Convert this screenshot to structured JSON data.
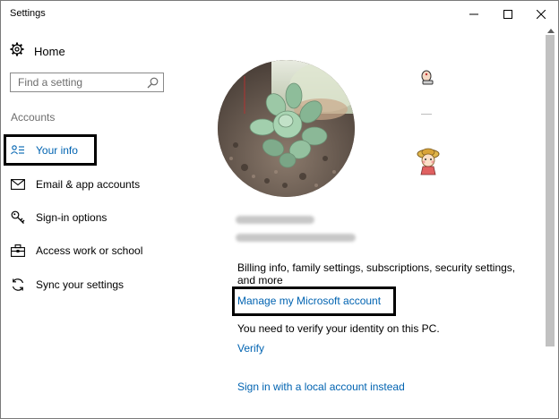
{
  "window": {
    "title": "Settings",
    "controls": [
      "minimize",
      "maximize",
      "close"
    ]
  },
  "sidebar": {
    "home_label": "Home",
    "search_placeholder": "Find a setting",
    "section_heading": "Accounts",
    "items": [
      {
        "label": "Your info",
        "icon": "person-card-icon",
        "active": true
      },
      {
        "label": "Email & app accounts",
        "icon": "mail-icon",
        "active": false
      },
      {
        "label": "Sign-in options",
        "icon": "key-icon",
        "active": false
      },
      {
        "label": "Access work or school",
        "icon": "briefcase-icon",
        "active": false
      },
      {
        "label": "Sync your settings",
        "icon": "sync-icon",
        "active": false
      }
    ]
  },
  "main": {
    "profile_picture": "succulent plant photo",
    "description": "Billing info, family settings, subscriptions, security settings, and more",
    "manage_account_link": "Manage my Microsoft account",
    "verify_notice": "You need to verify your identity on this PC.",
    "verify_link": "Verify",
    "local_account_link": "Sign in with a local account instead"
  },
  "colors": {
    "accent": "#0063b1",
    "highlight_box": "#000000",
    "secondary_text": "#6d6d6d"
  }
}
